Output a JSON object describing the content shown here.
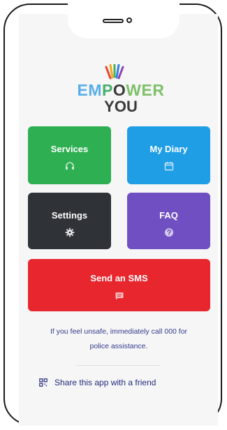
{
  "logo": {
    "line1_parts": [
      {
        "text": "EM",
        "color": "#5aaee8"
      },
      {
        "text": "P",
        "color": "#48b06a"
      },
      {
        "text": "O",
        "color": "#3a3a3a"
      },
      {
        "text": "WER",
        "color": "#7ec06a"
      }
    ],
    "line2": "YOU",
    "ray_colors": [
      "#e8462e",
      "#f5a623",
      "#4caf50",
      "#2f80ed",
      "#8e44ad"
    ]
  },
  "tiles": {
    "services": {
      "label": "Services",
      "icon": "headset-icon",
      "color": "#2eaf52"
    },
    "diary": {
      "label": "My Diary",
      "icon": "calendar-icon",
      "color": "#1f9ee6"
    },
    "settings": {
      "label": "Settings",
      "icon": "gear-icon",
      "color": "#2f3337"
    },
    "faq": {
      "label": "FAQ",
      "icon": "question-icon",
      "color": "#6f4fc2"
    },
    "sms": {
      "label": "Send an SMS",
      "icon": "message-icon",
      "color": "#e8262e"
    }
  },
  "warning": {
    "line1": "If you feel unsafe, immediately call 000 for",
    "line2": "police assistance."
  },
  "share": {
    "label": "Share this app with a friend",
    "icon": "qr-code-icon"
  }
}
